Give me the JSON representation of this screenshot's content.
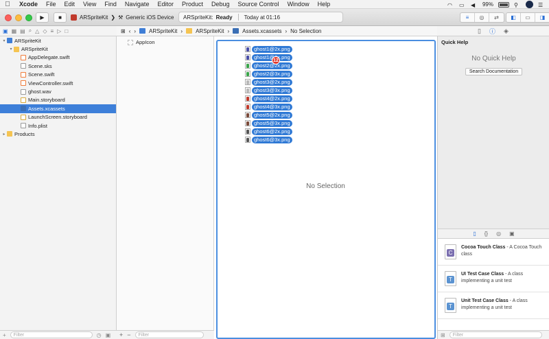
{
  "menubar": {
    "app": "Xcode",
    "items": [
      "File",
      "Edit",
      "View",
      "Find",
      "Navigate",
      "Editor",
      "Product",
      "Debug",
      "Source Control",
      "Window",
      "Help"
    ],
    "battery": "99%"
  },
  "toolbar": {
    "scheme": "ARSpriteKit",
    "device": "Generic iOS Device",
    "activity_project": "ARSpriteKit:",
    "activity_status": "Ready",
    "activity_time": "Today at 01:16"
  },
  "jumpbar": {
    "crumbs": [
      "ARSpriteKit",
      "ARSpriteKit",
      "Assets.xcassets",
      "No Selection"
    ]
  },
  "navigator": {
    "items": [
      {
        "label": "ARSpriteKit",
        "indent": 0,
        "disclosure": "▾",
        "icon": "project-icon"
      },
      {
        "label": "ARSpriteKit",
        "indent": 1,
        "disclosure": "▾",
        "icon": "folder-icon"
      },
      {
        "label": "AppDelegate.swift",
        "indent": 2,
        "disclosure": "",
        "icon": "swift-file-icon"
      },
      {
        "label": "Scene.sks",
        "indent": 2,
        "disclosure": "",
        "icon": "file-icon"
      },
      {
        "label": "Scene.swift",
        "indent": 2,
        "disclosure": "",
        "icon": "swift-file-icon"
      },
      {
        "label": "ViewController.swift",
        "indent": 2,
        "disclosure": "",
        "icon": "swift-file-icon"
      },
      {
        "label": "ghost.wav",
        "indent": 2,
        "disclosure": "",
        "icon": "file-icon"
      },
      {
        "label": "Main.storyboard",
        "indent": 2,
        "disclosure": "",
        "icon": "storyboard-icon"
      },
      {
        "label": "Assets.xcassets",
        "indent": 2,
        "disclosure": "",
        "icon": "assets-icon",
        "selected": true
      },
      {
        "label": "LaunchScreen.storyboard",
        "indent": 2,
        "disclosure": "",
        "icon": "storyboard-icon"
      },
      {
        "label": "Info.plist",
        "indent": 2,
        "disclosure": "",
        "icon": "file-icon"
      },
      {
        "label": "Products",
        "indent": 0,
        "disclosure": "▸",
        "icon": "folder-icon"
      }
    ],
    "filter_placeholder": "Filter"
  },
  "assets": {
    "items": [
      "AppIcon"
    ],
    "filter_placeholder": "Filter"
  },
  "editor": {
    "no_selection": "No Selection",
    "dragged_files": [
      {
        "name": "ghost1@2x.png",
        "color": "#4a4fa8"
      },
      {
        "name": "ghost1@3x.png",
        "color": "#4a4fa8"
      },
      {
        "name": "ghost2@2x.png",
        "color": "#3aa54a"
      },
      {
        "name": "ghost2@3x.png",
        "color": "#3aa54a"
      },
      {
        "name": "ghost3@2x.png",
        "color": "#b8b8b8"
      },
      {
        "name": "ghost3@3x.png",
        "color": "#b8b8b8"
      },
      {
        "name": "ghost4@2x.png",
        "color": "#c0392b"
      },
      {
        "name": "ghost4@3x.png",
        "color": "#c0392b"
      },
      {
        "name": "ghost5@2x.png",
        "color": "#7a4a3a"
      },
      {
        "name": "ghost5@3x.png",
        "color": "#7a4a3a"
      },
      {
        "name": "ghost6@2x.png",
        "color": "#555555"
      },
      {
        "name": "ghost6@3x.png",
        "color": "#555555"
      }
    ],
    "drag_count": "12"
  },
  "inspector": {
    "quick_help_title": "Quick Help",
    "no_quick_help": "No Quick Help",
    "search_button": "Search Documentation",
    "library": [
      {
        "name": "Cocoa Touch Class",
        "desc": " - A Cocoa Touch class",
        "glyph": "C",
        "color": "#7b6fb0"
      },
      {
        "name": "UI Test Case Class",
        "desc": " - A class implementing a unit test",
        "glyph": "T",
        "color": "#5b93d1"
      },
      {
        "name": "Unit Test Case Class",
        "desc": " - A class implementing a unit test",
        "glyph": "T",
        "color": "#5b93d1"
      }
    ],
    "filter_placeholder": "Filter"
  },
  "colors": {
    "accent": "#3d7fd9",
    "selection": "#3d7fd9",
    "drop_highlight": "#4a8ee0",
    "badge": "#e0362c"
  }
}
